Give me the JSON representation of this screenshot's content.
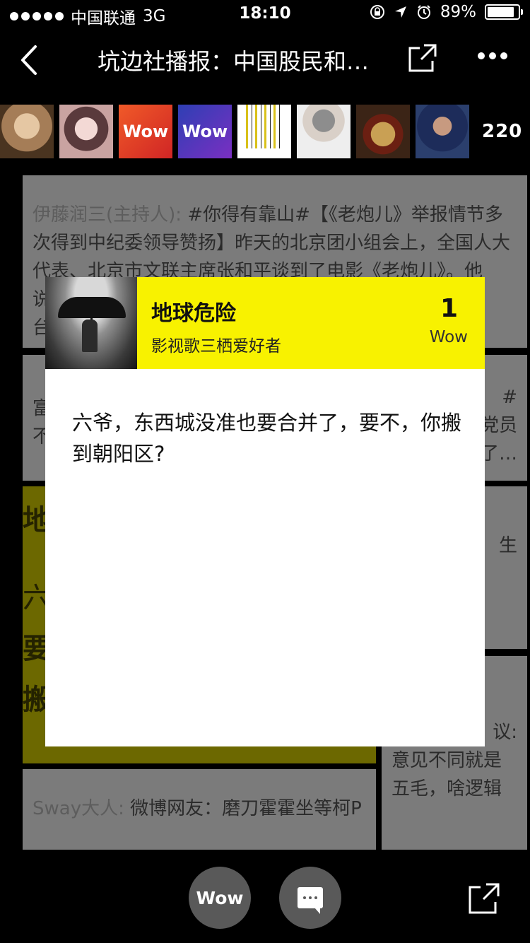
{
  "status_bar": {
    "carrier": "中国联通",
    "network": "3G",
    "time": "18:10",
    "battery": "89%",
    "battery_level": 0.89
  },
  "nav": {
    "title": "坑边社播报：中国股民和…",
    "icons": [
      "chevron-left-icon",
      "share-icon",
      "more-icon"
    ]
  },
  "reactors": {
    "avatars": [
      "avatar",
      "avatar",
      "Wow",
      "Wow",
      "avatar",
      "avatar",
      "avatar",
      "avatar"
    ],
    "wow_label": "Wow",
    "count": "220"
  },
  "cards": {
    "c1": {
      "user": "伊藤润三(主持人):",
      "text": " #你得有靠山#【《老炮儿》举报情节多次得到中纪委领导赞扬】昨天的北京团小组会上，全国人大代表、北京市文联主席张和平谈到了电影《老炮儿》。他说，《老",
      "line5": "台诉"
    },
    "c2": {
      "line1": "富坐",
      "line2": "不，"
    },
    "c3": {
      "line1": "#",
      "line2": "党员",
      "line3": "了…"
    },
    "c4": {
      "line1": "地",
      "line2": "六",
      "line3": "要",
      "line4": "搬"
    },
    "c5": {
      "line1": "生"
    },
    "c6": {
      "line1": "议:",
      "line2": "意见不同就是",
      "line3": "五毛，啥逻辑"
    },
    "c7": {
      "user": "Sway大人:",
      "text": " 微博网友：磨刀霍霍坐等柯P"
    }
  },
  "modal": {
    "name": "地球危险",
    "subtitle": "影视歌三栖爱好者",
    "wow_count": "1",
    "wow_label": "Wow",
    "message": "六爷，东西城没准也要合并了，要不，你搬到朝阳区?"
  },
  "bottom_bar": {
    "wow_button": "Wow",
    "icons": [
      "comment-icon",
      "share-icon"
    ]
  }
}
